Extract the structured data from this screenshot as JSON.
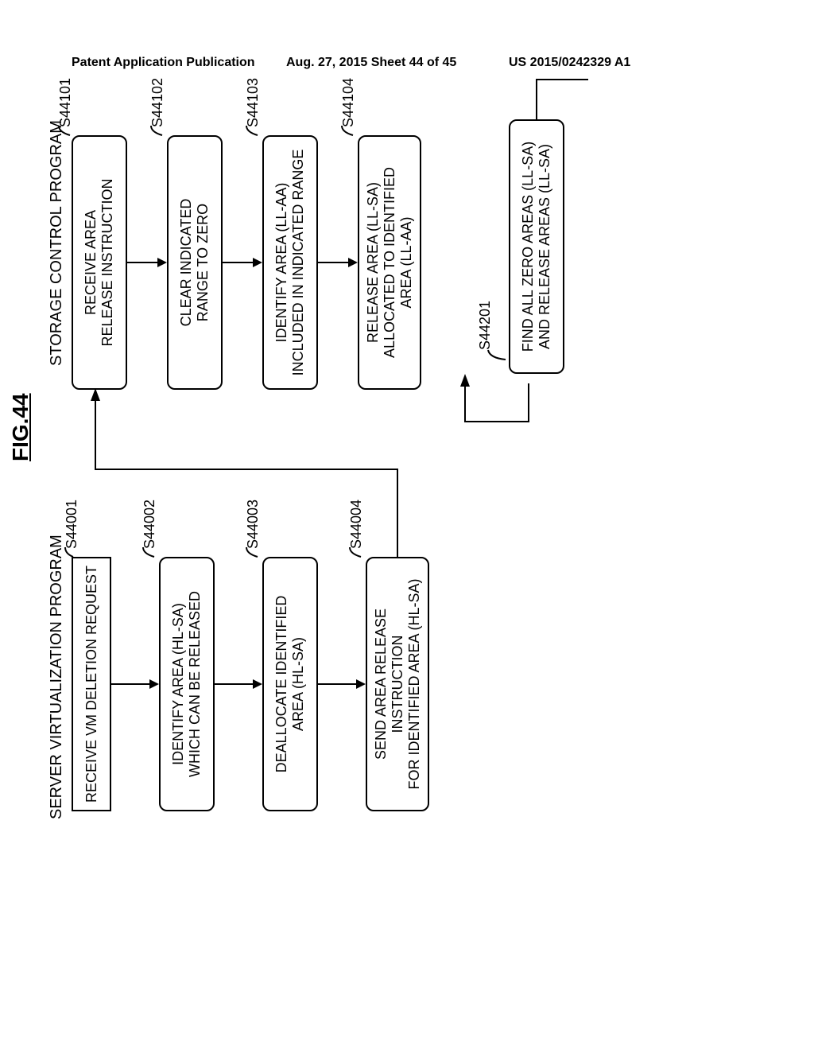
{
  "header": {
    "left": "Patent Application Publication",
    "center": "Aug. 27, 2015  Sheet 44 of 45",
    "right": "US 2015/0242329 A1"
  },
  "figure_label": "FIG.44",
  "columns": {
    "left_title": "SERVER VIRTUALIZATION PROGRAM",
    "right_title": "STORAGE CONTROL PROGRAM"
  },
  "left_steps": [
    {
      "ref": "S44001",
      "lines": [
        "RECEIVE VM DELETION REQUEST"
      ]
    },
    {
      "ref": "S44002",
      "lines": [
        "IDENTIFY AREA (HL-SA)",
        "WHICH CAN BE RELEASED"
      ]
    },
    {
      "ref": "S44003",
      "lines": [
        "DEALLOCATE IDENTIFIED",
        "AREA (HL-SA)"
      ]
    },
    {
      "ref": "S44004",
      "lines": [
        "SEND AREA RELEASE",
        "INSTRUCTION",
        "FOR IDENTIFIED AREA (HL-SA)"
      ]
    }
  ],
  "right_steps": [
    {
      "ref": "S44101",
      "lines": [
        "RECEIVE AREA",
        "RELEASE INSTRUCTION"
      ]
    },
    {
      "ref": "S44102",
      "lines": [
        "CLEAR INDICATED",
        "RANGE TO ZERO"
      ]
    },
    {
      "ref": "S44103",
      "lines": [
        "IDENTIFY AREA (LL-AA)",
        "INCLUDED IN INDICATED RANGE"
      ]
    },
    {
      "ref": "S44104",
      "lines": [
        "RELEASE AREA (LL-SA)",
        "ALLOCATED TO IDENTIFIED",
        "AREA (LL-AA)"
      ]
    },
    {
      "ref": "S44201",
      "lines": [
        "FIND ALL ZERO AREAS (LL-SA)",
        "AND RELEASE AREAS (LL-SA)"
      ]
    }
  ]
}
